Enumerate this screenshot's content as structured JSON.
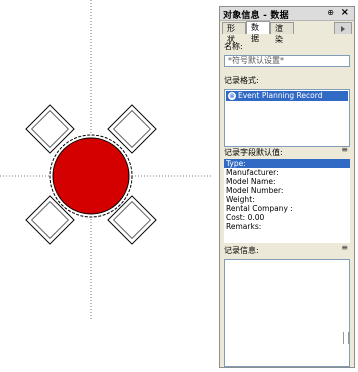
{
  "palette": {
    "title": "对象信息 - 数据",
    "pin_icon": "pin-icon",
    "close_icon": "close-icon",
    "tabs": [
      "形状",
      "数据",
      "渲染"
    ],
    "name_label": "名称:",
    "name_placeholder": "*符号默认设置*",
    "record_format_label": "记录格式:",
    "record_selected": "Event Planning Record",
    "field_values_label": "记录字段默认值:",
    "fields": [
      "Type:",
      "Manufacturer:",
      "Model Name:",
      "Model Number:",
      "Weight:",
      "Rental Company :",
      "Cost: 0.00",
      "Remarks:"
    ],
    "record_info_label": "记录信息:"
  },
  "colors": {
    "selection": "#316ac5",
    "table_red": "#d40000"
  }
}
